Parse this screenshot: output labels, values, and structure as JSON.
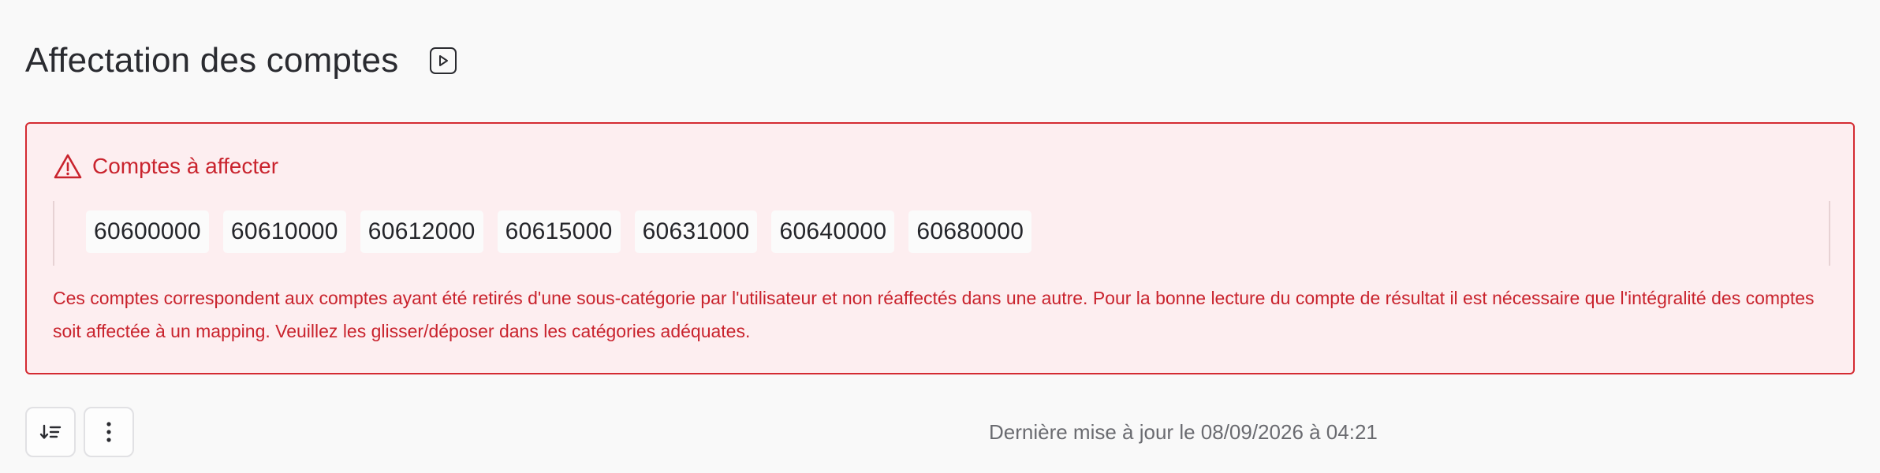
{
  "page": {
    "title": "Affectation des comptes",
    "video_icon": "play-video-icon"
  },
  "alert": {
    "icon": "warning-triangle-icon",
    "title": "Comptes à affecter",
    "accounts": [
      "60600000",
      "60610000",
      "60612000",
      "60615000",
      "60631000",
      "60640000",
      "60680000"
    ],
    "message": "Ces comptes correspondent aux comptes ayant été retirés d'une sous-catégorie par l'utilisateur et non réaffectés dans une autre. Pour la bonne lecture du compte de résultat il est nécessaire que l'intégralité des comptes soit affectée à un mapping. Veuillez les glisser/déposer dans les catégories adéquates.",
    "colors": {
      "accent": "#c9232d",
      "border": "#d42b32",
      "background": "#fdeef0"
    }
  },
  "toolbar": {
    "sort_icon": "sort-list-icon",
    "more_icon": "more-vertical-icon"
  },
  "status": {
    "last_update": "Dernière mise à jour le 08/09/2026 à 04:21"
  }
}
